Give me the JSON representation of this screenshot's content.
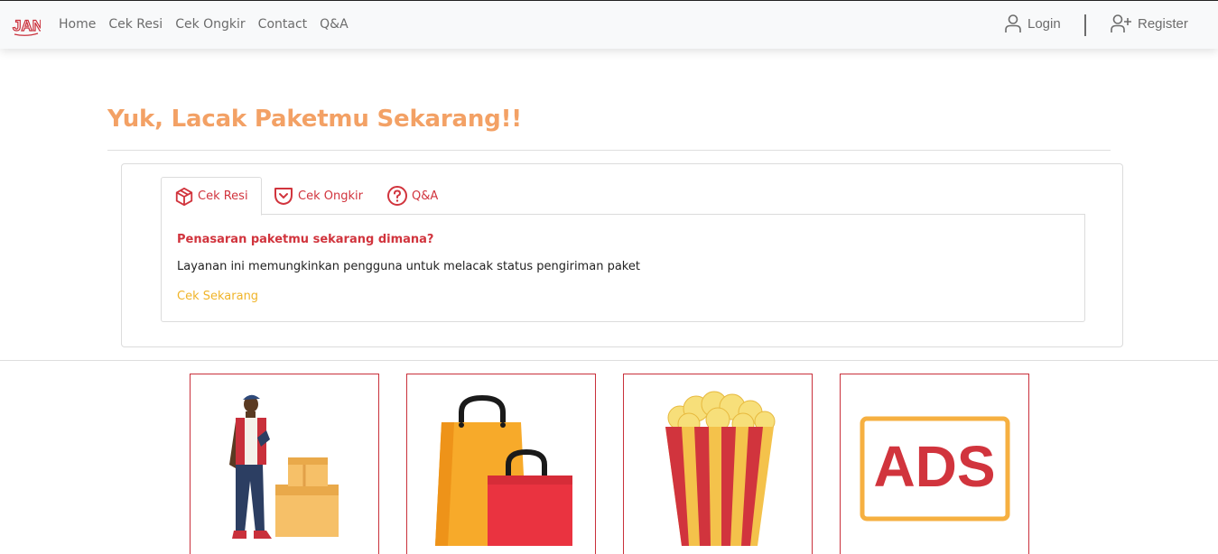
{
  "brand": {
    "logo_text": "JAN"
  },
  "nav": {
    "items": [
      "Home",
      "Cek Resi",
      "Cek Ongkir",
      "Contact",
      "Q&A"
    ]
  },
  "auth": {
    "login_label": "Login",
    "register_label": "Register"
  },
  "hero": {
    "headline": "Yuk, Lacak Paketmu Sekarang!!"
  },
  "tabs": [
    {
      "label": "Cek Resi",
      "icon": "box-icon",
      "active": true
    },
    {
      "label": "Cek Ongkir",
      "icon": "pocket-icon",
      "active": false
    },
    {
      "label": "Q&A",
      "icon": "question-circle-icon",
      "active": false
    }
  ],
  "panel": {
    "title": "Penasaran paketmu sekarang dimana?",
    "description": "Layanan ini memungkinkan pengguna untuk melacak status pengiriman paket",
    "link_label": "Cek Sekarang"
  },
  "promos": [
    {
      "icon": "courier-with-boxes-illustration"
    },
    {
      "icon": "shopping-bags-illustration"
    },
    {
      "icon": "popcorn-illustration"
    },
    {
      "icon": "ads-illustration",
      "text": "ADS"
    }
  ],
  "colors": {
    "accent_red": "#d1343d",
    "headline_orange": "#f3a165",
    "link_yellow": "#f0b429",
    "navbar_bg": "#f8f9fa"
  }
}
